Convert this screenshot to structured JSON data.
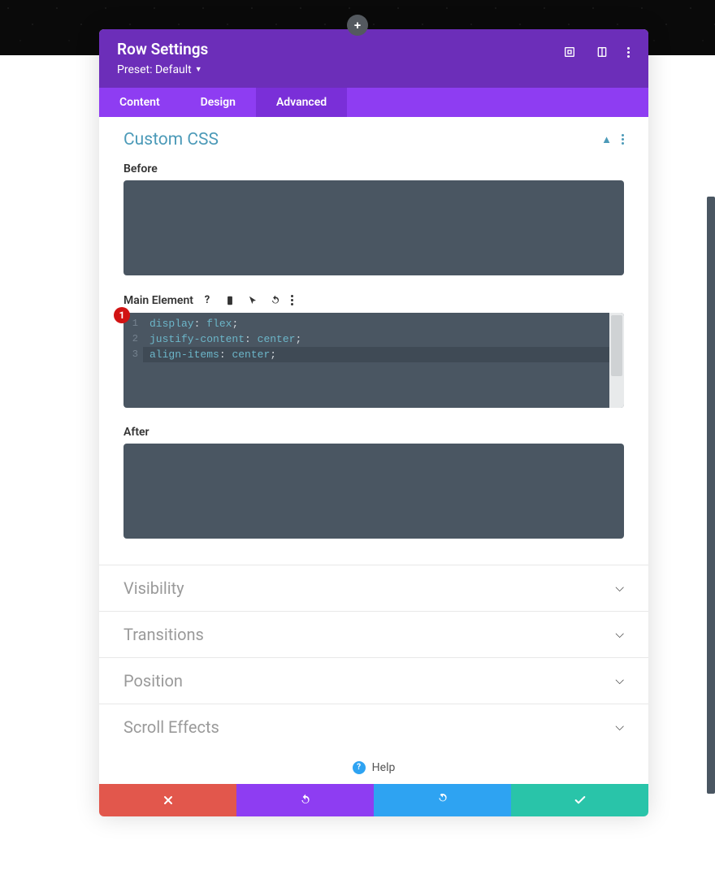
{
  "header": {
    "title": "Row Settings",
    "preset": "Preset: Default"
  },
  "tabs": [
    {
      "label": "Content",
      "active": false
    },
    {
      "label": "Design",
      "active": false
    },
    {
      "label": "Advanced",
      "active": true
    }
  ],
  "customCss": {
    "title": "Custom CSS",
    "before_label": "Before",
    "main_label": "Main Element",
    "after_label": "After",
    "badge": "1",
    "lines": [
      {
        "n": "1",
        "prop": "display",
        "val": "flex"
      },
      {
        "n": "2",
        "prop": "justify-content",
        "val": "center"
      },
      {
        "n": "3",
        "prop": "align-items",
        "val": "center"
      }
    ]
  },
  "accordions": [
    {
      "title": "Visibility"
    },
    {
      "title": "Transitions"
    },
    {
      "title": "Position"
    },
    {
      "title": "Scroll Effects"
    }
  ],
  "help": {
    "label": "Help"
  }
}
